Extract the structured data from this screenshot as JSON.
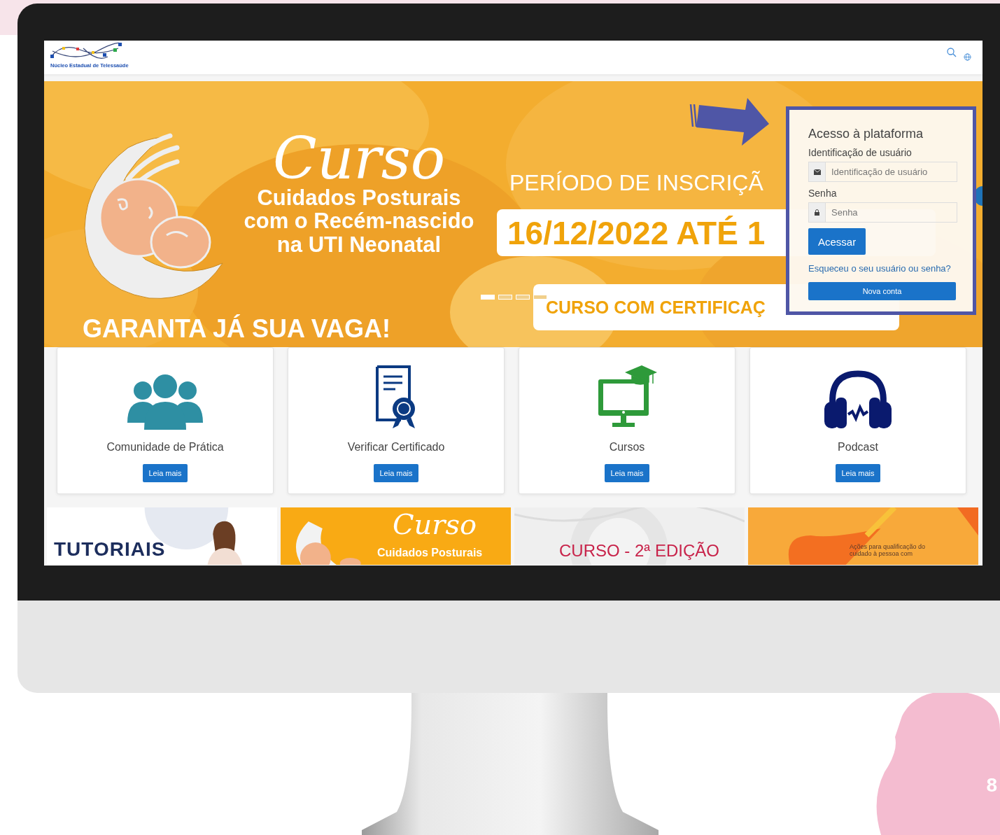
{
  "slide": {
    "page_number": "8"
  },
  "header": {
    "logo_text": "Núcleo Estadual de Telessaúde"
  },
  "banner": {
    "script_title": "Curso",
    "title_lines": [
      "Cuidados Posturais",
      "com o Recém-nascido",
      "na UTI Neonatal"
    ],
    "period": "PERÍODO DE INSCRIÇÃ",
    "dates": "16/12/2022 ATÉ 1",
    "certificate": "CURSO COM CERTIFICAÇ",
    "cta": "GARANTA JÁ SUA VAGA!",
    "dots": [
      {
        "selected": true
      },
      {
        "selected": false
      },
      {
        "selected": false
      },
      {
        "selected": false
      }
    ]
  },
  "login": {
    "title": "Acesso à plataforma",
    "username_label": "Identificação de usuário",
    "username_placeholder": "Identificação de usuário",
    "password_label": "Senha",
    "password_placeholder": "Senha",
    "submit": "Acessar",
    "forgot_link": "Esqueceu o seu usuário ou senha?",
    "new_account": "Nova conta"
  },
  "cards": [
    {
      "kind": "people",
      "title": "Comunidade de Prática",
      "button": "Leia mais"
    },
    {
      "kind": "certificate",
      "title": "Verificar Certificado",
      "button": "Leia mais"
    },
    {
      "kind": "computer",
      "title": "Cursos",
      "button": "Leia mais"
    },
    {
      "kind": "headphones",
      "title": "Podcast",
      "button": "Leia mais"
    }
  ],
  "thumbnails": [
    {
      "kind": "tutorials",
      "texts": [
        "TUTORIAIS"
      ]
    },
    {
      "kind": "course",
      "texts": [
        "Curso",
        "Cuidados Posturais"
      ]
    },
    {
      "kind": "edition",
      "texts": [
        "CURSO - 2ª EDIÇÃO"
      ]
    },
    {
      "kind": "telehans",
      "texts": [
        "Ações para qualificação do cuidado à pessoa com"
      ]
    }
  ]
}
